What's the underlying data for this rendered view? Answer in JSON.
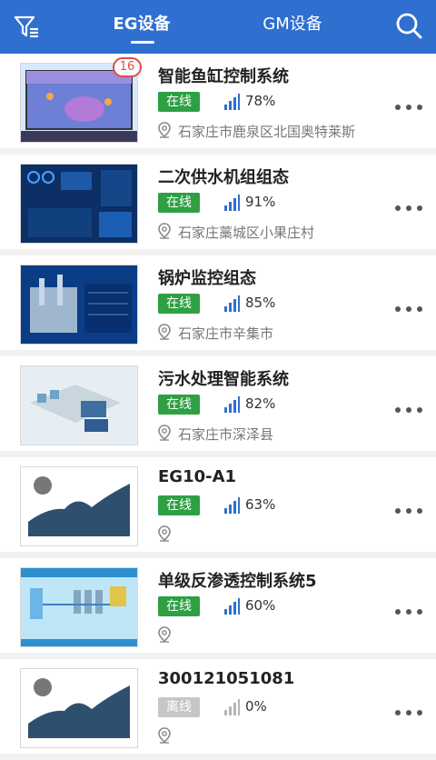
{
  "header": {
    "tabs": [
      {
        "label": "EG设备",
        "active": true
      },
      {
        "label": "GM设备",
        "active": false
      }
    ],
    "accent_color": "#2f6fd0"
  },
  "devices": [
    {
      "title": "智能鱼缸控制系统",
      "status": "在线",
      "online": true,
      "signal": "78%",
      "address": "石家庄市鹿泉区北国奥特莱斯",
      "badge": "16",
      "thumb": "aquarium"
    },
    {
      "title": "二次供水机组组态",
      "status": "在线",
      "online": true,
      "signal": "91%",
      "address": "石家庄藁城区小果庄村",
      "thumb": "water"
    },
    {
      "title": "锅炉监控组态",
      "status": "在线",
      "online": true,
      "signal": "85%",
      "address": "石家庄市辛集市",
      "thumb": "boiler"
    },
    {
      "title": "污水处理智能系统",
      "status": "在线",
      "online": true,
      "signal": "82%",
      "address": "石家庄市深泽县",
      "thumb": "sewage"
    },
    {
      "title": "EG10-A1",
      "status": "在线",
      "online": true,
      "signal": "63%",
      "address": "",
      "thumb": "placeholder"
    },
    {
      "title": "单级反渗透控制系统5",
      "status": "在线",
      "online": true,
      "signal": "60%",
      "address": "",
      "thumb": "ro"
    },
    {
      "title": "300121051081",
      "status": "离线",
      "online": false,
      "signal": "0%",
      "address": "",
      "thumb": "placeholder"
    }
  ]
}
